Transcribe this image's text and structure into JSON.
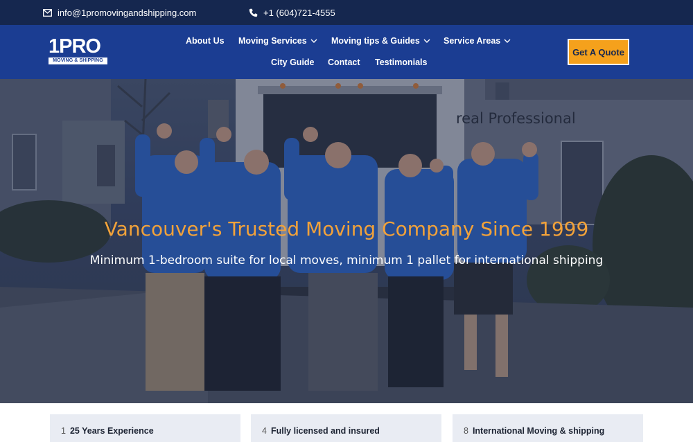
{
  "topbar": {
    "email": "info@1promovingandshipping.com",
    "phone": "+1 (604)721-4555"
  },
  "logo": {
    "big_text": "1PRO",
    "strip_text": "MOVING & SHIPPING"
  },
  "nav": {
    "about": "About Us",
    "services": "Moving Services",
    "tips": "Moving tips & Guides",
    "areas": "Service Areas",
    "city": "City Guide",
    "contact": "Contact",
    "testimonials": "Testimonials"
  },
  "cta": {
    "quote": "Get A Quote"
  },
  "hero": {
    "title": "Vancouver's Trusted Moving Company Since 1999",
    "subtitle": "Minimum 1-bedroom suite for local moves, minimum 1 pallet for international shipping",
    "truck_lettering": "real Professional"
  },
  "features": [
    {
      "num": "1",
      "label": "25 Years Experience"
    },
    {
      "num": "4",
      "label": "Fully licensed and insured"
    },
    {
      "num": "8",
      "label": "International Moving & shipping"
    }
  ],
  "colors": {
    "topbar": "#15274f",
    "navbar": "#1b3d92",
    "accent": "#f5a11c",
    "hero_title": "#f2a23a"
  }
}
